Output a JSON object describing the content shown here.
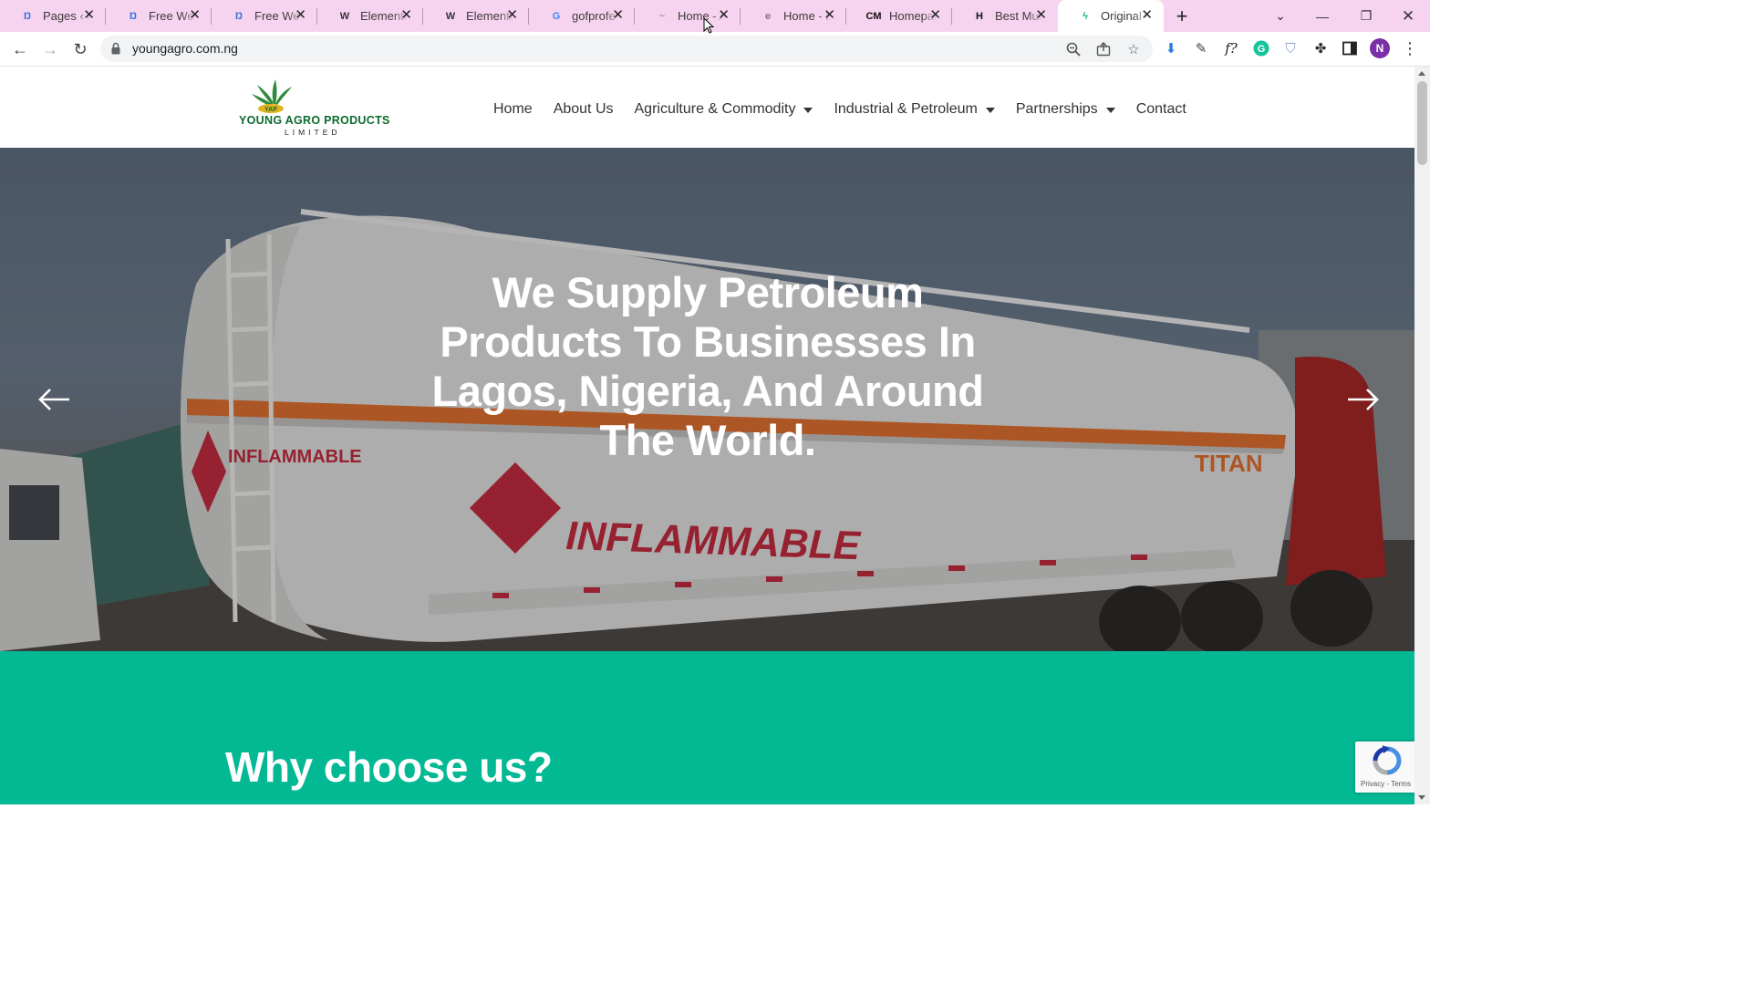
{
  "browser": {
    "tabs": [
      {
        "title": "Pages ‹ Cl",
        "icon": "cloudways-icon",
        "color": "#2f6fe0",
        "glyph": "Ŋ"
      },
      {
        "title": "Free Web",
        "icon": "site-icon",
        "color": "#2f6fe0",
        "glyph": "Ŋ"
      },
      {
        "title": "Free Web",
        "icon": "site-icon",
        "color": "#2f6fe0",
        "glyph": "Ŋ"
      },
      {
        "title": "Elemento",
        "icon": "wordpress-icon",
        "color": "#333333",
        "glyph": "W"
      },
      {
        "title": "Elemento",
        "icon": "wordpress-icon",
        "color": "#333333",
        "glyph": "W"
      },
      {
        "title": "gofprofe",
        "icon": "google-icon",
        "color": "#4285f4",
        "glyph": "G"
      },
      {
        "title": "Home - A",
        "icon": "site-icon",
        "color": "#999999",
        "glyph": "~"
      },
      {
        "title": "Home - E",
        "icon": "site-icon",
        "color": "#777777",
        "glyph": "e"
      },
      {
        "title": "Homepag",
        "icon": "cm-icon",
        "color": "#111111",
        "glyph": "CM"
      },
      {
        "title": "Best Mult",
        "icon": "h-icon",
        "color": "#111111",
        "glyph": "H"
      },
      {
        "title": "Original -",
        "icon": "bolt-icon",
        "color": "#19b394",
        "glyph": "ϟ"
      }
    ],
    "active_tab_index": 10,
    "url": "youngagro.com.ng",
    "profile_initial": "N"
  },
  "site": {
    "logo_brand": "YOUNG AGRO PRODUCTS",
    "logo_sub": "LIMITED",
    "logo_badge": "YAP",
    "menu": [
      {
        "label": "Home",
        "dropdown": false
      },
      {
        "label": "About Us",
        "dropdown": false
      },
      {
        "label": "Agriculture & Commodity",
        "dropdown": true
      },
      {
        "label": "Industrial & Petroleum",
        "dropdown": true
      },
      {
        "label": "Partnerships",
        "dropdown": true
      },
      {
        "label": "Contact",
        "dropdown": false
      }
    ],
    "hero_heading": "We Supply Petroleum Products To Businesses In Lagos, Nigeria, And Around The World.",
    "hero_truck_text": "INFLAMMABLE",
    "hero_truck_text_2": "INFLAMMABLE",
    "hero_truck_brand": "TITAN",
    "section_heading": "Why choose us?",
    "recaptcha_text": "Privacy - Terms"
  },
  "colors": {
    "tab_strip": "#f6d3ee",
    "accent_green": "#03b994",
    "logo_green": "#0d6b2f"
  }
}
